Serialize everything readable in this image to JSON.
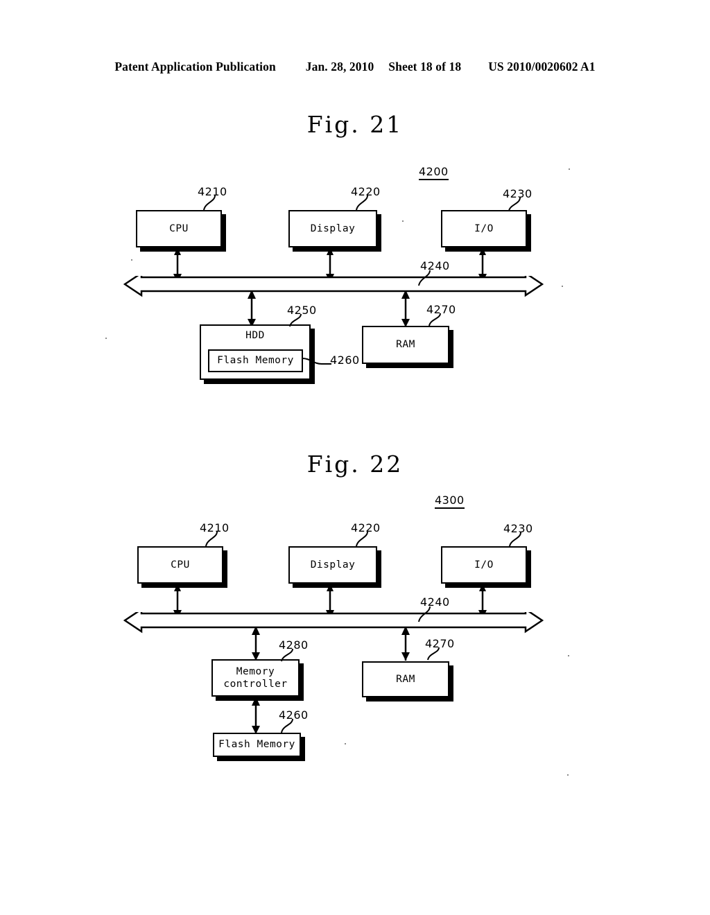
{
  "header": {
    "publication": "Patent Application Publication",
    "date": "Jan. 28, 2010",
    "sheet": "Sheet 18 of 18",
    "patent_number": "US 2010/0020602 A1"
  },
  "figures": [
    {
      "title": "Fig. 21",
      "system_ref": "4200",
      "blocks": {
        "cpu": "CPU",
        "display": "Display",
        "io": "I/O",
        "hdd": "HDD",
        "flash": "Flash Memory",
        "ram": "RAM"
      },
      "refs": {
        "cpu": "4210",
        "display": "4220",
        "io": "4230",
        "bus": "4240",
        "hdd": "4250",
        "flash": "4260",
        "ram": "4270"
      }
    },
    {
      "title": "Fig. 22",
      "system_ref": "4300",
      "blocks": {
        "cpu": "CPU",
        "display": "Display",
        "io": "I/O",
        "memory_controller_line1": "Memory",
        "memory_controller_line2": "controller",
        "flash": "Flash Memory",
        "ram": "RAM"
      },
      "refs": {
        "cpu": "4210",
        "display": "4220",
        "io": "4230",
        "bus": "4240",
        "memory_controller": "4280",
        "flash": "4260",
        "ram": "4270"
      }
    }
  ]
}
